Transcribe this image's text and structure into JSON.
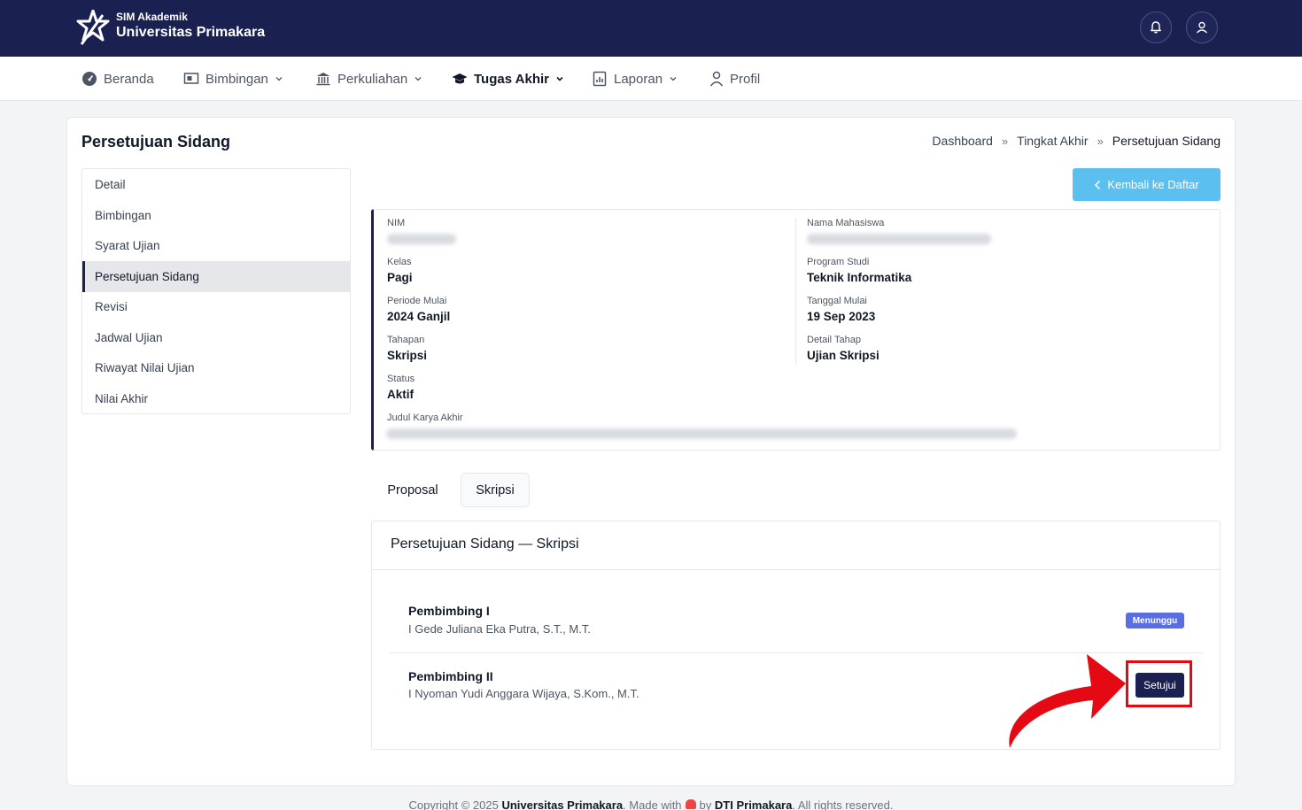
{
  "header": {
    "brand_sub": "SIM Akademik",
    "brand_main": "Universitas Primakara",
    "icons": [
      "bell-icon",
      "user-icon"
    ]
  },
  "nav": {
    "items": [
      {
        "label": "Beranda",
        "icon": "dashboard-icon",
        "dropdown": false
      },
      {
        "label": "Bimbingan",
        "icon": "presentation-icon",
        "dropdown": true
      },
      {
        "label": "Perkuliahan",
        "icon": "building-icon",
        "dropdown": true
      },
      {
        "label": "Tugas Akhir",
        "icon": "graduation-cap-icon",
        "dropdown": true,
        "active": true
      },
      {
        "label": "Laporan",
        "icon": "report-icon",
        "dropdown": true
      },
      {
        "label": "Profil",
        "icon": "user-icon",
        "dropdown": false
      }
    ]
  },
  "page": {
    "title": "Persetujuan Sidang",
    "breadcrumb": [
      "Dashboard",
      "Tingkat Akhir",
      "Persetujuan Sidang"
    ],
    "breadcrumb_sep": "»"
  },
  "sidemenu": {
    "items": [
      "Detail",
      "Bimbingan",
      "Syarat Ujian",
      "Persetujuan Sidang",
      "Revisi",
      "Jadwal Ujian",
      "Riwayat Nilai Ujian",
      "Nilai Akhir"
    ],
    "active": "Persetujuan Sidang"
  },
  "back_button": {
    "label": "Kembali ke Daftar"
  },
  "student_info": {
    "nim": {
      "label": "NIM",
      "value": ""
    },
    "nama": {
      "label": "Nama Mahasiswa",
      "value": ""
    },
    "kelas": {
      "label": "Kelas",
      "value": "Pagi"
    },
    "prodi": {
      "label": "Program Studi",
      "value": "Teknik Informatika"
    },
    "periode": {
      "label": "Periode Mulai",
      "value": "2024 Ganjil"
    },
    "tanggal": {
      "label": "Tanggal Mulai",
      "value": "19 Sep 2023"
    },
    "tahapan": {
      "label": "Tahapan",
      "value": "Skripsi"
    },
    "detail_tahap": {
      "label": "Detail Tahap",
      "value": "Ujian Skripsi"
    },
    "status": {
      "label": "Status",
      "value": "Aktif"
    },
    "judul": {
      "label": "Judul Karya Akhir",
      "value": ""
    }
  },
  "tabs": [
    {
      "label": "Proposal",
      "active": false
    },
    {
      "label": "Skripsi",
      "active": true
    }
  ],
  "panel": {
    "title": "Persetujuan Sidang — Skripsi",
    "rows": [
      {
        "title": "Pembimbing I",
        "name": "I Gede Juliana Eka Putra, S.T., M.T.",
        "status_badge": "Menunggu"
      },
      {
        "title": "Pembimbing II",
        "name": "I Nyoman Yudi Anggara Wijaya, S.Kom., M.T.",
        "action_label": "Setujui"
      }
    ]
  },
  "footer": {
    "prefix": "Copyright © 2025",
    "org": "Universitas Primakara",
    "made_with": ". Made with",
    "by": "by",
    "team": "DTI Primakara",
    "suffix": ". All rights reserved."
  },
  "colors": {
    "primary_navy": "#1a2151",
    "info_blue": "#5bc0f0",
    "badge_indigo": "#5b6ee1",
    "annotation_red": "#e50914"
  }
}
